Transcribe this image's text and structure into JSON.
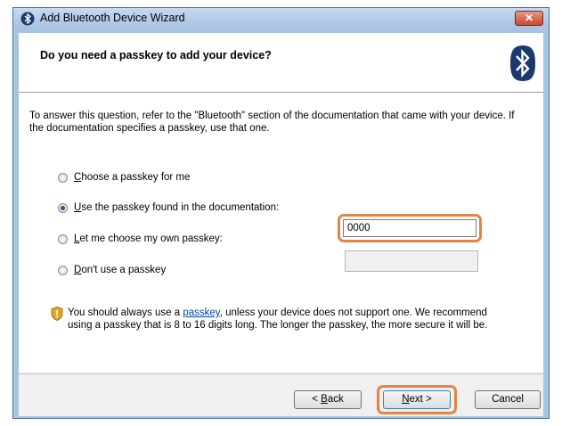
{
  "window": {
    "title": "Add Bluetooth Device Wizard",
    "close_label": "✕"
  },
  "header": {
    "title": "Do you need a passkey to add your device?"
  },
  "main": {
    "intro": "To answer this question, refer to the \"Bluetooth\" section of the documentation that came with your device. If the documentation specifies a passkey, use that one.",
    "options": [
      {
        "accel": "C",
        "rest": "hoose a passkey for me",
        "checked": false
      },
      {
        "accel": "U",
        "rest": "se the passkey found in the documentation:",
        "checked": true
      },
      {
        "accel": "L",
        "rest": "et me choose my own passkey:",
        "checked": false
      },
      {
        "accel": "D",
        "rest_before": "",
        "rest": "on't use a passkey",
        "checked": false
      }
    ],
    "passkey_value": "0000",
    "own_passkey_value": "",
    "note_before_link": "You should always use a ",
    "note_link": "passkey",
    "note_after_link": ", unless your device does not support one. We recommend using a passkey that is 8 to 16 digits long. The longer the passkey, the more secure it will be."
  },
  "footer": {
    "back_prefix": "< ",
    "back_accel": "B",
    "back_rest": "ack",
    "next_accel": "N",
    "next_rest": "ext >",
    "cancel_label": "Cancel"
  },
  "colors": {
    "highlight": "#e8823f",
    "bluetooth_logo": "#1b3a6b",
    "link": "#0645ad"
  },
  "icons": [
    "bluetooth-icon",
    "bluetooth-logo-icon",
    "shield-warning-icon",
    "close-icon"
  ]
}
